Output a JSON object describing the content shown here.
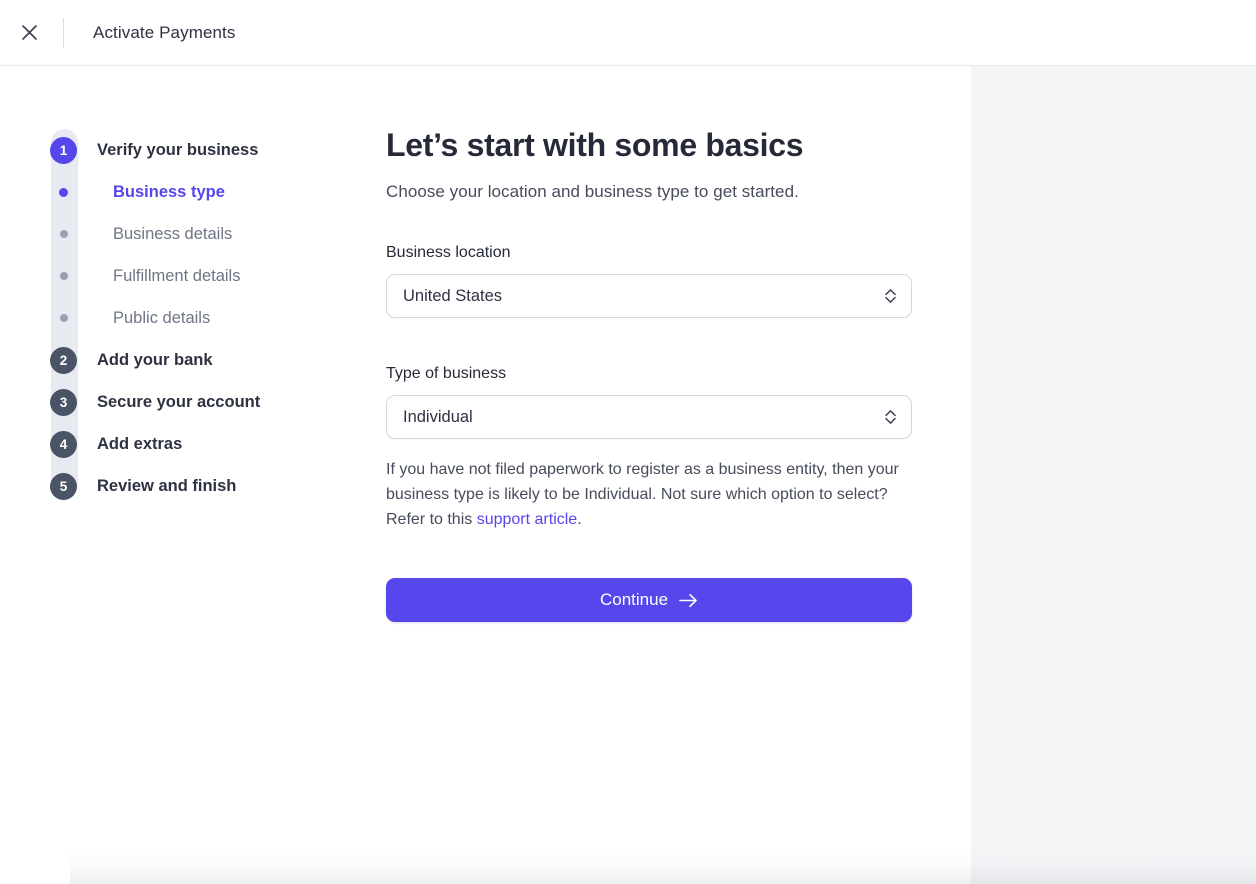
{
  "header": {
    "close_icon": "close-icon",
    "title": "Activate Payments"
  },
  "sidebar": {
    "steps": [
      {
        "number": "1",
        "label": "Verify your business",
        "state": "active",
        "type": "step"
      },
      {
        "label": "Business type",
        "state": "active",
        "type": "substep"
      },
      {
        "label": "Business details",
        "state": "inactive",
        "type": "substep"
      },
      {
        "label": "Fulfillment details",
        "state": "inactive",
        "type": "substep"
      },
      {
        "label": "Public details",
        "state": "inactive",
        "type": "substep"
      },
      {
        "number": "2",
        "label": "Add your bank",
        "state": "inactive",
        "type": "step"
      },
      {
        "number": "3",
        "label": "Secure your account",
        "state": "inactive",
        "type": "step"
      },
      {
        "number": "4",
        "label": "Add extras",
        "state": "inactive",
        "type": "step"
      },
      {
        "number": "5",
        "label": "Review and finish",
        "state": "inactive",
        "type": "step"
      }
    ]
  },
  "main": {
    "title": "Let’s start with some basics",
    "subtitle": "Choose your location and business type to get started.",
    "business_location": {
      "label": "Business location",
      "value": "United States",
      "icon": "chevron-up-down-icon"
    },
    "business_type": {
      "label": "Type of business",
      "value": "Individual",
      "icon": "chevron-up-down-icon"
    },
    "help_text": {
      "before_link": "If you have not filed paperwork to register as a business entity, then your business type is likely to be Individual. Not sure which option to select? Refer to this ",
      "link": "support article",
      "after_link": "."
    },
    "continue_button": {
      "label": "Continue",
      "icon": "arrow-right-icon"
    }
  },
  "colors": {
    "accent": "#5646eb",
    "step_inactive": "#4b5366",
    "rail": "#e7eaf0",
    "side_panel": "#f4f5f7"
  }
}
